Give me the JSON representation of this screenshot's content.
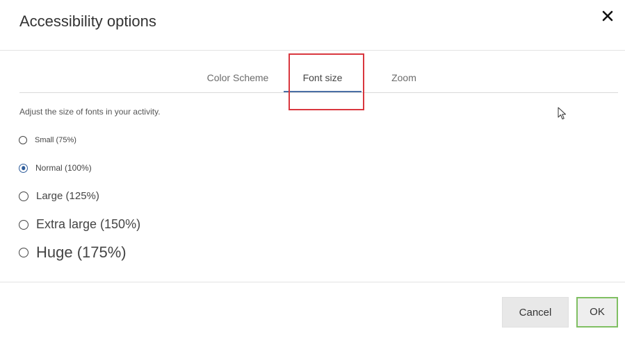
{
  "dialog": {
    "title": "Accessibility options",
    "close_icon": "close-icon"
  },
  "tabs": [
    {
      "label": "Color Scheme",
      "active": false
    },
    {
      "label": "Font size",
      "active": true
    },
    {
      "label": "Zoom",
      "active": false
    }
  ],
  "font_size": {
    "instructions": "Adjust the size of fonts in your activity.",
    "options": [
      {
        "label": "Small (75%)",
        "checked": false
      },
      {
        "label": "Normal (100%)",
        "checked": true
      },
      {
        "label": "Large (125%)",
        "checked": false
      },
      {
        "label": "Extra large (150%)",
        "checked": false
      },
      {
        "label": "Huge (175%)",
        "checked": false
      }
    ]
  },
  "footer": {
    "cancel_label": "Cancel",
    "ok_label": "OK"
  },
  "colors": {
    "active_tab_underline": "#4a6fa5",
    "highlight_box": "#d9363e",
    "ok_border": "#7fbf62",
    "radio_checked": "#2f5d9b"
  },
  "icons": {
    "close": "close-icon",
    "cursor": "mouse-pointer-icon"
  }
}
